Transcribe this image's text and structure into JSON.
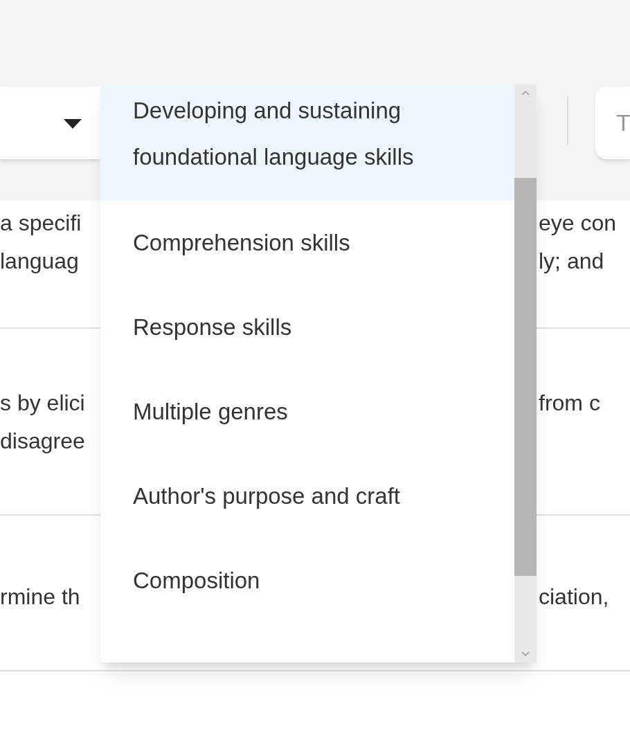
{
  "filter_field": {
    "placeholder": "T"
  },
  "table_rows": [
    {
      "left": [
        "a specifi",
        "languag"
      ],
      "right": [
        "eye con",
        "ly; and"
      ]
    },
    {
      "left": [
        "s by elici",
        "disagree"
      ],
      "right": [
        "from c"
      ]
    },
    {
      "left": [
        "rmine th"
      ],
      "right": [
        "ciation,"
      ]
    }
  ],
  "dropdown": {
    "options": [
      {
        "label": "Developing and sustaining foundational language skills",
        "selected": true
      },
      {
        "label": "Comprehension skills",
        "selected": false
      },
      {
        "label": "Response skills",
        "selected": false
      },
      {
        "label": "Multiple genres",
        "selected": false
      },
      {
        "label": "Author's purpose and craft",
        "selected": false
      },
      {
        "label": "Composition",
        "selected": false
      }
    ]
  }
}
